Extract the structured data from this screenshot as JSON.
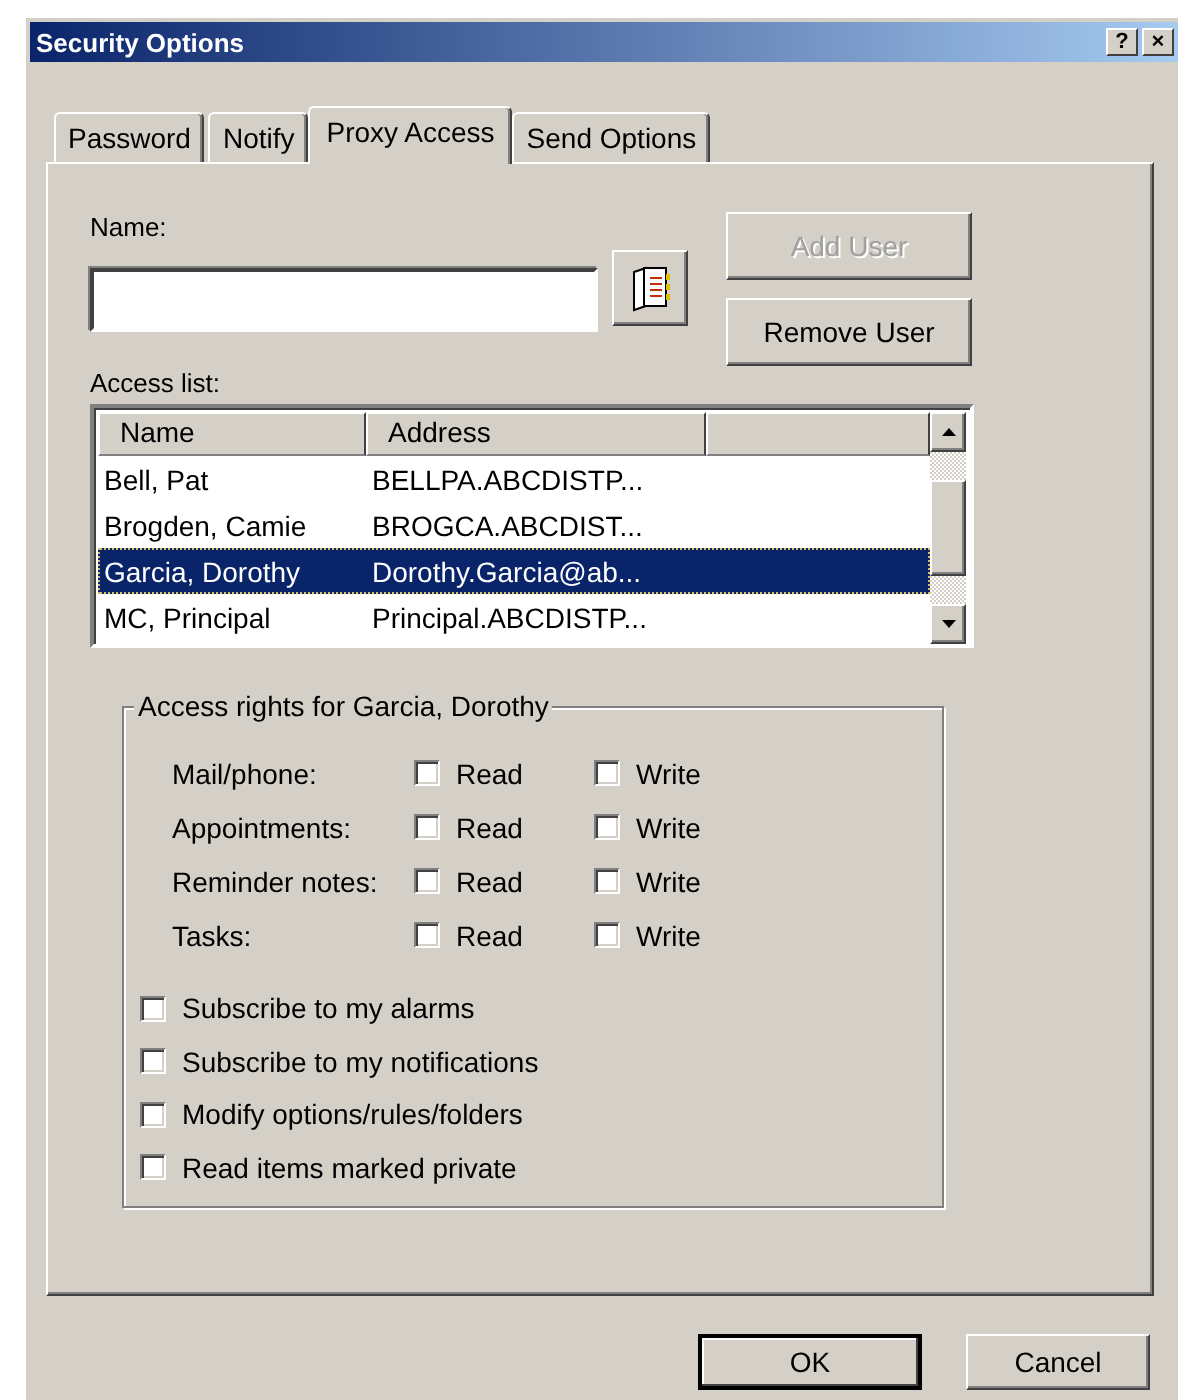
{
  "window": {
    "title": "Security Options",
    "help": "?",
    "close": "×"
  },
  "tabs": [
    {
      "label": "Password",
      "selected": false
    },
    {
      "label": "Notify",
      "selected": false
    },
    {
      "label": "Proxy Access",
      "selected": true
    },
    {
      "label": "Send Options",
      "selected": false
    }
  ],
  "name_field": {
    "label": "Name:"
  },
  "side_buttons": [
    {
      "label": "Add User",
      "disabled": true
    },
    {
      "label": "Remove User",
      "disabled": false
    }
  ],
  "access_list": {
    "label": "Access list:",
    "columns": [
      "Name",
      "Address"
    ],
    "rows": [
      {
        "name": "Bell, Pat",
        "address": "BELLPA.ABCDISTP...",
        "selected": false
      },
      {
        "name": "Brogden, Camie",
        "address": "BROGCA.ABCDIST...",
        "selected": false
      },
      {
        "name": "Garcia, Dorothy",
        "address": "Dorothy.Garcia@ab...",
        "selected": true
      },
      {
        "name": "MC, Principal",
        "address": "Principal.ABCDISTP...",
        "selected": false
      }
    ]
  },
  "access_rights": {
    "title": "Access rights for Garcia, Dorothy",
    "rows": [
      {
        "label": "Mail/phone:",
        "read": {
          "label": "Read",
          "checked": false
        },
        "write": {
          "label": "Write",
          "checked": false
        }
      },
      {
        "label": "Appointments:",
        "read": {
          "label": "Read",
          "checked": false
        },
        "write": {
          "label": "Write",
          "checked": false
        }
      },
      {
        "label": "Reminder notes:",
        "read": {
          "label": "Read",
          "checked": false
        },
        "write": {
          "label": "Write",
          "checked": false
        }
      },
      {
        "label": "Tasks:",
        "read": {
          "label": "Read",
          "checked": false
        },
        "write": {
          "label": "Write",
          "checked": false
        }
      }
    ],
    "options": [
      {
        "label": "Subscribe to my alarms",
        "checked": false
      },
      {
        "label": "Subscribe to my notifications",
        "checked": false
      },
      {
        "label": "Modify options/rules/folders",
        "checked": false
      },
      {
        "label": "Read items marked private",
        "checked": false
      }
    ]
  },
  "footer_buttons": [
    {
      "label": "OK",
      "default": true
    },
    {
      "label": "Cancel",
      "default": false
    }
  ]
}
